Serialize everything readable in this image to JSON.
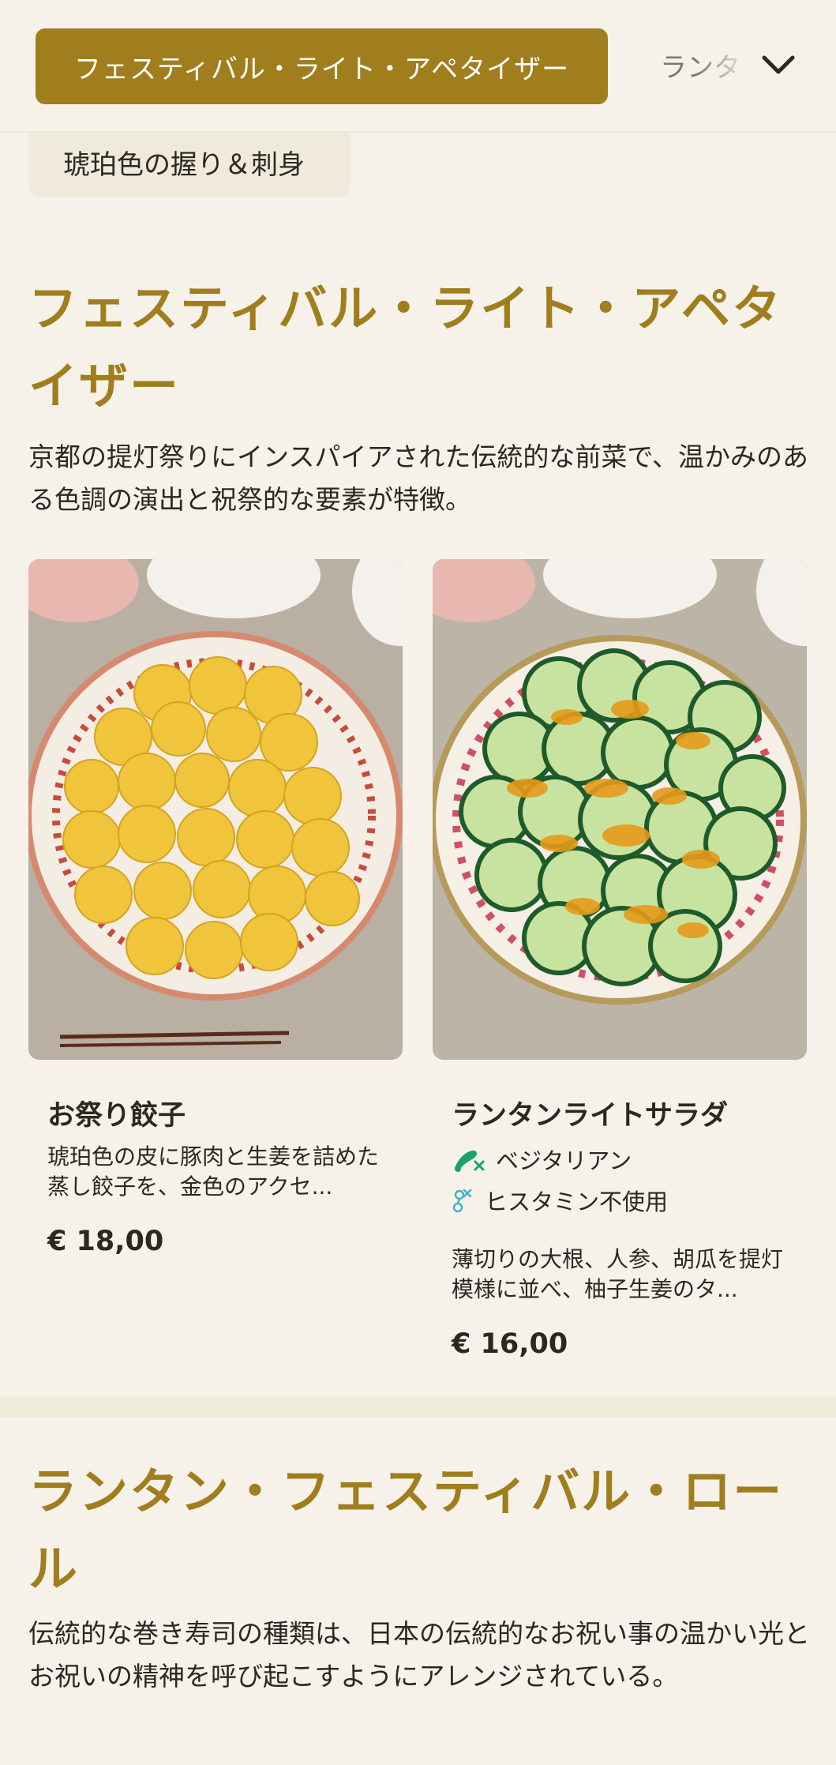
{
  "nav": {
    "active_category": "フェスティバル・ライト・アペタイザー",
    "next_category": "ランタ",
    "previous_category": "琥珀色の握り＆刺身"
  },
  "section1": {
    "title": "フェスティバル・ライト・アペタイザー",
    "description": "京都の提灯祭りにインスパイアされた伝統的な前菜で、温かみのある色調の演出と祝祭的な要素が特徴。"
  },
  "items": [
    {
      "name": "お祭り餃子",
      "description": "琥珀色の皮に豚肉と生姜を詰めた蒸し餃子を、金色のアクセ...",
      "price": "€ 18,00",
      "image_icon": "dumplings-photo"
    },
    {
      "name": "ランタンライトサラダ",
      "tags": [
        {
          "label": "ベジタリアン",
          "icon": "no-meat-icon",
          "color": "#1aa36b"
        },
        {
          "label": "ヒスタミン不使用",
          "icon": "no-histamine-icon",
          "color": "#3fb6c6"
        }
      ],
      "description": "薄切りの大根、人参、胡瓜を提灯模様に並べ、柚子生姜のタ...",
      "price": "€ 16,00",
      "image_icon": "cucumber-salad-photo"
    }
  ],
  "section2": {
    "title": "ランタン・フェスティバル・ロール",
    "description": "伝統的な巻き寿司の種類は、日本の伝統的なお祝い事の温かい光とお祝いの精神を呼び起こすようにアレンジされている。"
  },
  "colors": {
    "accent": "#a07e1e",
    "background": "#f6f2ea",
    "chip": "#efeadb"
  }
}
